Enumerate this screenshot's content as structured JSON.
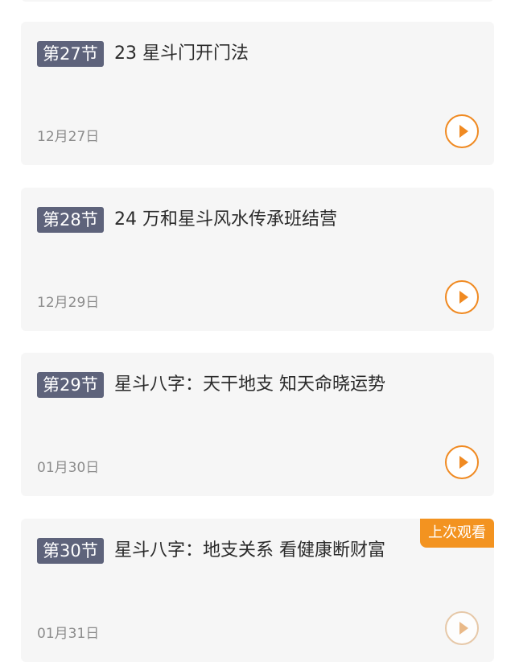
{
  "lessons": [
    {
      "tag": "第27节",
      "title": "23 星斗门开门法",
      "date": "12月27日"
    },
    {
      "tag": "第28节",
      "title": "24 万和星斗风水传承班结营",
      "date": "12月29日"
    },
    {
      "tag": "第29节",
      "title": "星斗八字：天干地支 知天命晓运势",
      "date": "01月30日"
    },
    {
      "tag": "第30节",
      "title": "星斗八字：地支关系 看健康断财富",
      "date": "01月31日",
      "badge": "上次观看"
    }
  ]
}
